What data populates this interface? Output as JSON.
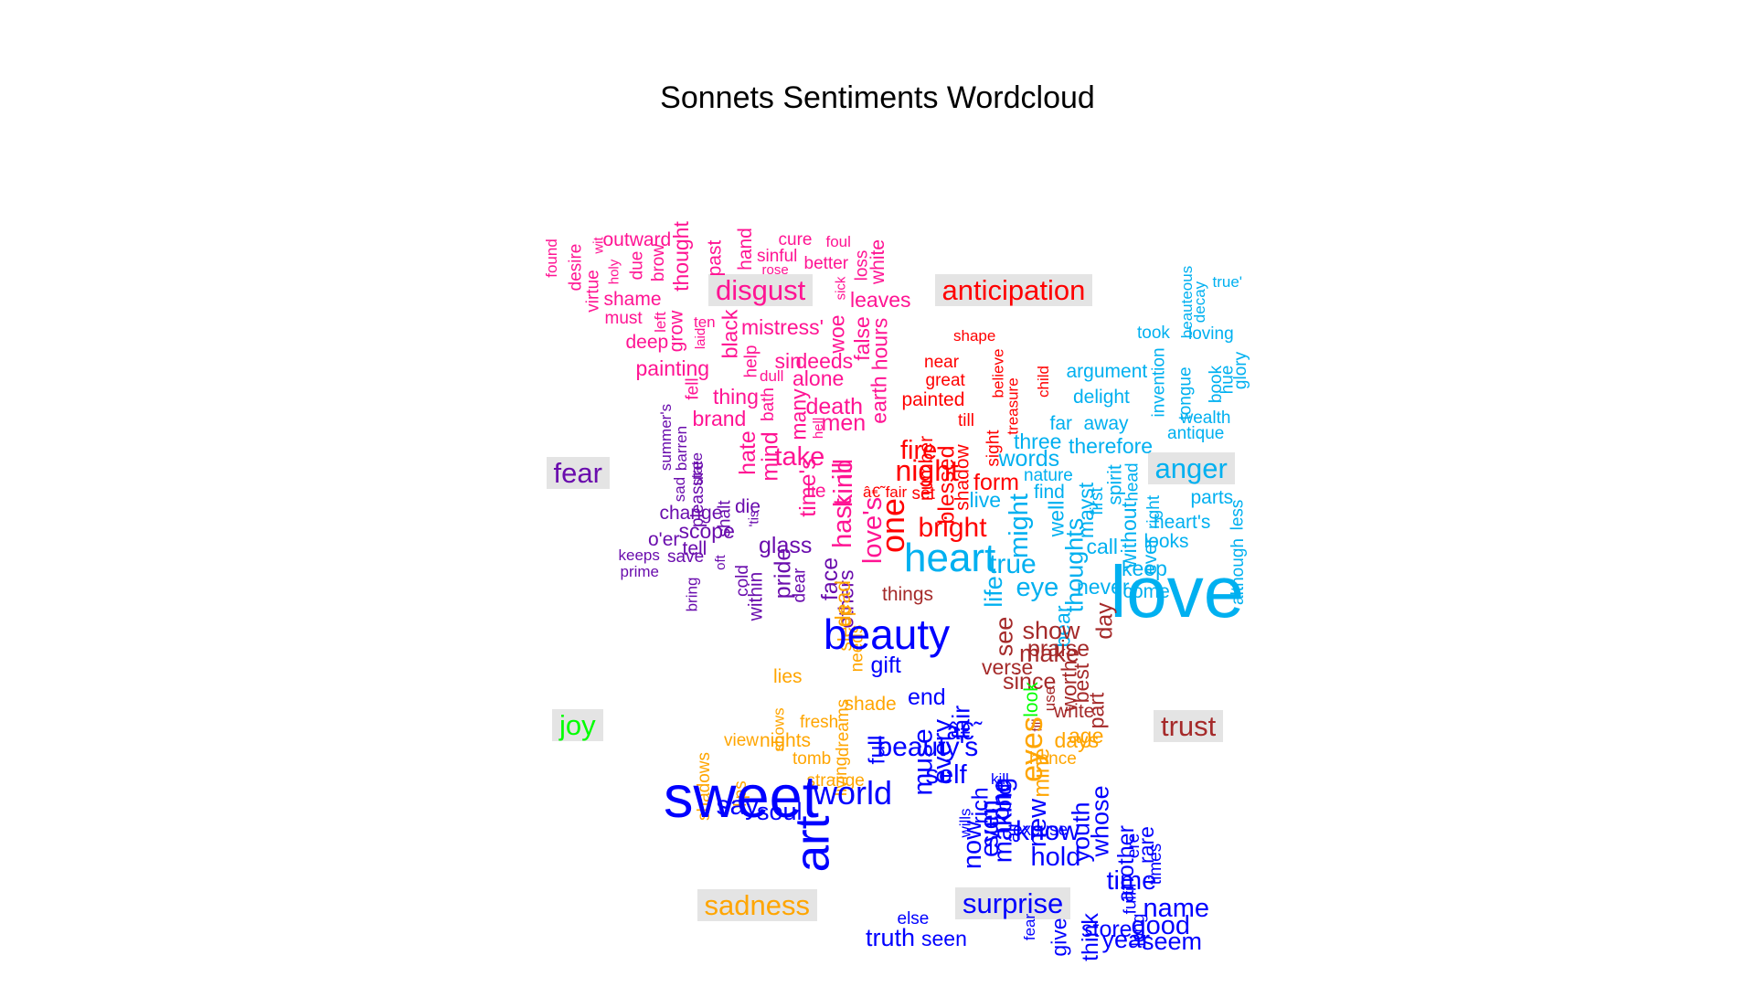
{
  "title": "Sonnets Sentiments Wordcloud",
  "colors": {
    "disgust": "#ff1493",
    "anticipation": "#ff0000",
    "fear": "#6a0dad",
    "anger": "#00b0f0",
    "joy": "#00ff00",
    "trust": "#a52a2a",
    "sadness": "#ffa500",
    "surprise": "#0000ff"
  },
  "labels": [
    "disgust",
    "anticipation",
    "fear",
    "anger",
    "joy",
    "trust",
    "sadness",
    "surprise"
  ],
  "words": [
    {
      "t": "found",
      "g": "disgust",
      "f": 0.9,
      "r": 1
    },
    {
      "t": "desire",
      "g": "disgust",
      "f": 1.0,
      "r": 1
    },
    {
      "t": "virtue",
      "g": "disgust",
      "f": 1.0,
      "r": 1
    },
    {
      "t": "wit",
      "g": "disgust",
      "f": 0.8,
      "r": 1
    },
    {
      "t": "holy",
      "g": "disgust",
      "f": 0.8,
      "r": 1
    },
    {
      "t": "outward",
      "g": "disgust",
      "f": 1.1,
      "r": 0
    },
    {
      "t": "due",
      "g": "disgust",
      "f": 1.0,
      "r": 1
    },
    {
      "t": "brow",
      "g": "disgust",
      "f": 1.0,
      "r": 1
    },
    {
      "t": "thought",
      "g": "disgust",
      "f": 1.2,
      "r": 1
    },
    {
      "t": "past",
      "g": "disgust",
      "f": 1.1,
      "r": 1
    },
    {
      "t": "hand",
      "g": "disgust",
      "f": 1.1,
      "r": 1
    },
    {
      "t": "cure",
      "g": "disgust",
      "f": 1.0,
      "r": 0
    },
    {
      "t": "foul",
      "g": "disgust",
      "f": 0.9,
      "r": 0
    },
    {
      "t": "sinful",
      "g": "disgust",
      "f": 1.0,
      "r": 0
    },
    {
      "t": "rose",
      "g": "disgust",
      "f": 0.8,
      "r": 0
    },
    {
      "t": "better",
      "g": "disgust",
      "f": 1.0,
      "r": 0
    },
    {
      "t": "sick",
      "g": "disgust",
      "f": 0.8,
      "r": 1
    },
    {
      "t": "loss",
      "g": "disgust",
      "f": 1.0,
      "r": 1
    },
    {
      "t": "white",
      "g": "disgust",
      "f": 1.1,
      "r": 1
    },
    {
      "t": "shame",
      "g": "disgust",
      "f": 1.1,
      "r": 0
    },
    {
      "t": "must",
      "g": "disgust",
      "f": 1.0,
      "r": 0
    },
    {
      "t": "left",
      "g": "disgust",
      "f": 0.9,
      "r": 1
    },
    {
      "t": "ten",
      "g": "disgust",
      "f": 0.9,
      "r": 0
    },
    {
      "t": "grow",
      "g": "disgust",
      "f": 1.1,
      "r": 1
    },
    {
      "t": "leaves",
      "g": "disgust",
      "f": 1.2,
      "r": 0
    },
    {
      "t": "deep",
      "g": "disgust",
      "f": 1.1,
      "r": 0
    },
    {
      "t": "laid",
      "g": "disgust",
      "f": 0.8,
      "r": 1
    },
    {
      "t": "black",
      "g": "disgust",
      "f": 1.2,
      "r": 1
    },
    {
      "t": "mistress'",
      "g": "disgust",
      "f": 1.2,
      "r": 0
    },
    {
      "t": "woe",
      "g": "disgust",
      "f": 1.2,
      "r": 1
    },
    {
      "t": "false",
      "g": "disgust",
      "f": 1.2,
      "r": 1
    },
    {
      "t": "painting",
      "g": "disgust",
      "f": 1.2,
      "r": 0
    },
    {
      "t": "help",
      "g": "disgust",
      "f": 1.0,
      "r": 1
    },
    {
      "t": "sin",
      "g": "disgust",
      "f": 1.2,
      "r": 0
    },
    {
      "t": "deeds",
      "g": "disgust",
      "f": 1.2,
      "r": 0
    },
    {
      "t": "fell",
      "g": "disgust",
      "f": 1.0,
      "r": 1
    },
    {
      "t": "dull",
      "g": "disgust",
      "f": 0.9,
      "r": 0
    },
    {
      "t": "alone",
      "g": "disgust",
      "f": 1.2,
      "r": 0
    },
    {
      "t": "thing",
      "g": "disgust",
      "f": 1.2,
      "r": 0
    },
    {
      "t": "bath",
      "g": "disgust",
      "f": 1.0,
      "r": 1
    },
    {
      "t": "death",
      "g": "disgust",
      "f": 1.3,
      "r": 0
    },
    {
      "t": "brand",
      "g": "disgust",
      "f": 1.2,
      "r": 0
    },
    {
      "t": "many",
      "g": "disgust",
      "f": 1.2,
      "r": 1
    },
    {
      "t": "men",
      "g": "disgust",
      "f": 1.3,
      "r": 0
    },
    {
      "t": "hell",
      "g": "disgust",
      "f": 0.8,
      "r": 1
    },
    {
      "t": "earth",
      "g": "disgust",
      "f": 1.2,
      "r": 1
    },
    {
      "t": "hours",
      "g": "disgust",
      "f": 1.2,
      "r": 1
    },
    {
      "t": "hate",
      "g": "disgust",
      "f": 1.3,
      "r": 1
    },
    {
      "t": "mind",
      "g": "disgust",
      "f": 1.3,
      "r": 1
    },
    {
      "t": "take",
      "g": "disgust",
      "f": 1.5,
      "r": 0
    },
    {
      "t": "time's",
      "g": "disgust",
      "f": 1.3,
      "r": 1
    },
    {
      "t": "lie",
      "g": "disgust",
      "f": 1.1,
      "r": 0
    },
    {
      "t": "ill",
      "g": "disgust",
      "f": 1.5,
      "r": 1
    },
    {
      "t": "kind",
      "g": "disgust",
      "f": 1.5,
      "r": 1
    },
    {
      "t": "hast",
      "g": "disgust",
      "f": 1.5,
      "r": 1
    },
    {
      "t": "love's",
      "g": "disgust",
      "f": 1.5,
      "r": 1
    },
    {
      "t": "shape",
      "g": "anticipation",
      "f": 0.9,
      "r": 0
    },
    {
      "t": "near",
      "g": "anticipation",
      "f": 1.0,
      "r": 0
    },
    {
      "t": "great",
      "g": "anticipation",
      "f": 1.0,
      "r": 0
    },
    {
      "t": "believe",
      "g": "anticipation",
      "f": 0.9,
      "r": 1
    },
    {
      "t": "child",
      "g": "anticipation",
      "f": 0.9,
      "r": 1
    },
    {
      "t": "painted",
      "g": "anticipation",
      "f": 1.1,
      "r": 0
    },
    {
      "t": "treasure",
      "g": "anticipation",
      "f": 0.9,
      "r": 1
    },
    {
      "t": "till",
      "g": "anticipation",
      "f": 1.0,
      "r": 0
    },
    {
      "t": "sight",
      "g": "anticipation",
      "f": 1.0,
      "r": 1
    },
    {
      "t": "number",
      "g": "anticipation",
      "f": 1.1,
      "r": 1
    },
    {
      "t": "shadow",
      "g": "anticipation",
      "f": 1.1,
      "r": 1
    },
    {
      "t": "fire",
      "g": "anticipation",
      "f": 1.5,
      "r": 0
    },
    {
      "t": "night",
      "g": "anticipation",
      "f": 1.7,
      "r": 0
    },
    {
      "t": "blessed",
      "g": "anticipation",
      "f": 1.3,
      "r": 1
    },
    {
      "t": "form",
      "g": "anticipation",
      "f": 1.3,
      "r": 0
    },
    {
      "t": "â€˜fair",
      "g": "anticipation",
      "f": 0.9,
      "r": 0
    },
    {
      "t": "set",
      "g": "anticipation",
      "f": 1.0,
      "r": 0
    },
    {
      "t": "one",
      "g": "anticipation",
      "f": 1.9,
      "r": 1
    },
    {
      "t": "bright",
      "g": "anticipation",
      "f": 1.6,
      "r": 0
    },
    {
      "t": "summer's",
      "g": "fear",
      "f": 0.9,
      "r": 1
    },
    {
      "t": "barren",
      "g": "fear",
      "f": 0.9,
      "r": 1
    },
    {
      "t": "sad",
      "g": "fear",
      "f": 0.9,
      "r": 1
    },
    {
      "t": "state",
      "g": "fear",
      "f": 0.9,
      "r": 1
    },
    {
      "t": "pleasure",
      "g": "fear",
      "f": 1.0,
      "r": 1
    },
    {
      "t": "change",
      "g": "fear",
      "f": 1.1,
      "r": 0
    },
    {
      "t": "shalt",
      "g": "fear",
      "f": 1.0,
      "r": 1
    },
    {
      "t": "die",
      "g": "fear",
      "f": 1.1,
      "r": 0
    },
    {
      "t": "scope",
      "g": "fear",
      "f": 1.2,
      "r": 0
    },
    {
      "t": "'tis",
      "g": "fear",
      "f": 0.8,
      "r": 1
    },
    {
      "t": "o'er",
      "g": "fear",
      "f": 1.1,
      "r": 0
    },
    {
      "t": "tell",
      "g": "fear",
      "f": 1.1,
      "r": 0
    },
    {
      "t": "glass",
      "g": "fear",
      "f": 1.3,
      "r": 0
    },
    {
      "t": "keeps",
      "g": "fear",
      "f": 0.9,
      "r": 0
    },
    {
      "t": "save",
      "g": "fear",
      "f": 1.0,
      "r": 0
    },
    {
      "t": "oft",
      "g": "fear",
      "f": 0.8,
      "r": 1
    },
    {
      "t": "cold",
      "g": "fear",
      "f": 1.0,
      "r": 1
    },
    {
      "t": "within",
      "g": "fear",
      "f": 1.1,
      "r": 1
    },
    {
      "t": "pride",
      "g": "fear",
      "f": 1.3,
      "r": 1
    },
    {
      "t": "dear",
      "g": "fear",
      "f": 1.0,
      "r": 1
    },
    {
      "t": "prime",
      "g": "fear",
      "f": 0.9,
      "r": 0
    },
    {
      "t": "bring",
      "g": "fear",
      "f": 0.9,
      "r": 1
    },
    {
      "t": "face",
      "g": "fear",
      "f": 1.3,
      "r": 1
    },
    {
      "t": "others",
      "g": "fear",
      "f": 1.2,
      "r": 1
    },
    {
      "t": "true'",
      "g": "anger",
      "f": 0.9,
      "r": 0
    },
    {
      "t": "beauteous",
      "g": "anger",
      "f": 0.9,
      "r": 1
    },
    {
      "t": "decay",
      "g": "anger",
      "f": 0.9,
      "r": 1
    },
    {
      "t": "took",
      "g": "anger",
      "f": 1.0,
      "r": 0
    },
    {
      "t": "loving",
      "g": "anger",
      "f": 1.0,
      "r": 0
    },
    {
      "t": "argument",
      "g": "anger",
      "f": 1.1,
      "r": 0
    },
    {
      "t": "invention",
      "g": "anger",
      "f": 1.0,
      "r": 1
    },
    {
      "t": "tongue",
      "g": "anger",
      "f": 1.0,
      "r": 1
    },
    {
      "t": "book",
      "g": "anger",
      "f": 1.0,
      "r": 1
    },
    {
      "t": "hue",
      "g": "anger",
      "f": 1.0,
      "r": 1
    },
    {
      "t": "glory",
      "g": "anger",
      "f": 1.0,
      "r": 1
    },
    {
      "t": "delight",
      "g": "anger",
      "f": 1.1,
      "r": 0
    },
    {
      "t": "antique",
      "g": "anger",
      "f": 1.0,
      "r": 0
    },
    {
      "t": "wealth",
      "g": "anger",
      "f": 1.0,
      "r": 0
    },
    {
      "t": "far",
      "g": "anger",
      "f": 1.1,
      "r": 0
    },
    {
      "t": "away",
      "g": "anger",
      "f": 1.1,
      "r": 0
    },
    {
      "t": "three",
      "g": "anger",
      "f": 1.2,
      "r": 0
    },
    {
      "t": "therefore",
      "g": "anger",
      "f": 1.2,
      "r": 0
    },
    {
      "t": "words",
      "g": "anger",
      "f": 1.3,
      "r": 0
    },
    {
      "t": "nature",
      "g": "anger",
      "f": 1.0,
      "r": 0
    },
    {
      "t": "find",
      "g": "anger",
      "f": 1.1,
      "r": 0
    },
    {
      "t": "first",
      "g": "anger",
      "f": 1.0,
      "r": 1
    },
    {
      "t": "spirit",
      "g": "anger",
      "f": 1.1,
      "r": 1
    },
    {
      "t": "head",
      "g": "anger",
      "f": 1.0,
      "r": 1
    },
    {
      "t": "parts",
      "g": "anger",
      "f": 1.1,
      "r": 0
    },
    {
      "t": "live",
      "g": "anger",
      "f": 1.2,
      "r": 0
    },
    {
      "t": "might",
      "g": "anger",
      "f": 1.5,
      "r": 1
    },
    {
      "t": "well",
      "g": "anger",
      "f": 1.2,
      "r": 1
    },
    {
      "t": "mayst",
      "g": "anger",
      "f": 1.2,
      "r": 1
    },
    {
      "t": "right",
      "g": "anger",
      "f": 1.0,
      "r": 1
    },
    {
      "t": "heart's",
      "g": "anger",
      "f": 1.1,
      "r": 0
    },
    {
      "t": "less",
      "g": "anger",
      "f": 1.0,
      "r": 1
    },
    {
      "t": "call",
      "g": "anger",
      "f": 1.2,
      "r": 0
    },
    {
      "t": "without",
      "g": "anger",
      "f": 1.2,
      "r": 1
    },
    {
      "t": "looks",
      "g": "anger",
      "f": 1.1,
      "r": 0
    },
    {
      "t": "ever",
      "g": "anger",
      "f": 1.1,
      "r": 1
    },
    {
      "t": "keep",
      "g": "anger",
      "f": 1.2,
      "r": 0
    },
    {
      "t": "although",
      "g": "anger",
      "f": 1.0,
      "r": 1
    },
    {
      "t": "heart",
      "g": "anger",
      "f": 2.3,
      "r": 0
    },
    {
      "t": "true",
      "g": "anger",
      "f": 1.6,
      "r": 0
    },
    {
      "t": "eye",
      "g": "anger",
      "f": 1.5,
      "r": 0
    },
    {
      "t": "life",
      "g": "anger",
      "f": 1.4,
      "r": 1
    },
    {
      "t": "thoughts",
      "g": "anger",
      "f": 1.4,
      "r": 1
    },
    {
      "t": "bear",
      "g": "anger",
      "f": 1.2,
      "r": 1
    },
    {
      "t": "never",
      "g": "anger",
      "f": 1.2,
      "r": 0
    },
    {
      "t": "come",
      "g": "anger",
      "f": 1.1,
      "r": 0
    },
    {
      "t": "love",
      "g": "anger",
      "f": 4.2,
      "r": 0
    },
    {
      "t": "things",
      "g": "trust",
      "f": 1.1,
      "r": 0
    },
    {
      "t": "day",
      "g": "trust",
      "f": 1.3,
      "r": 1
    },
    {
      "t": "show",
      "g": "trust",
      "f": 1.4,
      "r": 0
    },
    {
      "t": "see",
      "g": "trust",
      "f": 1.4,
      "r": 1
    },
    {
      "t": "make",
      "g": "trust",
      "f": 1.4,
      "r": 0
    },
    {
      "t": "praise",
      "g": "trust",
      "f": 1.3,
      "r": 0
    },
    {
      "t": "since",
      "g": "trust",
      "f": 1.3,
      "r": 0
    },
    {
      "t": "best",
      "g": "trust",
      "f": 1.2,
      "r": 1
    },
    {
      "t": "verse",
      "g": "trust",
      "f": 1.2,
      "r": 0
    },
    {
      "t": "write",
      "g": "trust",
      "f": 1.1,
      "r": 0
    },
    {
      "t": "worth",
      "g": "trust",
      "f": 1.2,
      "r": 1
    },
    {
      "t": "part",
      "g": "trust",
      "f": 1.2,
      "r": 1
    },
    {
      "t": "use",
      "g": "trust",
      "f": 0.9,
      "r": 1
    },
    {
      "t": "fill",
      "g": "trust",
      "f": 0.8,
      "r": 1
    },
    {
      "t": "look",
      "g": "joy",
      "f": 1.1,
      "r": 1
    },
    {
      "t": "age",
      "g": "sadness",
      "f": 1.2,
      "r": 0
    },
    {
      "t": "hence",
      "g": "sadness",
      "f": 1.0,
      "r": 0
    },
    {
      "t": "eyes",
      "g": "sadness",
      "f": 1.8,
      "r": 1
    },
    {
      "t": "days",
      "g": "sadness",
      "f": 1.2,
      "r": 0
    },
    {
      "t": "mine",
      "g": "sadness",
      "f": 1.3,
      "r": 1
    },
    {
      "t": "dead",
      "g": "sadness",
      "f": 1.2,
      "r": 1
    },
    {
      "t": "sleep",
      "g": "sadness",
      "f": 1.1,
      "r": 1
    },
    {
      "t": "needs",
      "g": "sadness",
      "f": 1.0,
      "r": 1
    },
    {
      "t": "lies",
      "g": "sadness",
      "f": 1.1,
      "r": 0
    },
    {
      "t": "shade",
      "g": "sadness",
      "f": 1.1,
      "r": 0
    },
    {
      "t": "fresh",
      "g": "sadness",
      "f": 1.0,
      "r": 0
    },
    {
      "t": "dreams",
      "g": "sadness",
      "f": 1.0,
      "r": 1
    },
    {
      "t": "shows",
      "g": "sadness",
      "f": 0.9,
      "r": 1
    },
    {
      "t": "view",
      "g": "sadness",
      "f": 1.0,
      "r": 0
    },
    {
      "t": "nights",
      "g": "sadness",
      "f": 1.1,
      "r": 0
    },
    {
      "t": "tomb",
      "g": "sadness",
      "f": 1.0,
      "r": 0
    },
    {
      "t": "living",
      "g": "sadness",
      "f": 1.0,
      "r": 1
    },
    {
      "t": "shadows",
      "g": "sadness",
      "f": 1.0,
      "r": 1
    },
    {
      "t": "lips",
      "g": "sadness",
      "f": 1.0,
      "r": 1
    },
    {
      "t": "strange",
      "g": "sadness",
      "f": 1.0,
      "r": 0
    },
    {
      "t": "world",
      "g": "surprise",
      "f": 1.9,
      "r": 0
    },
    {
      "t": "sweet",
      "g": "surprise",
      "f": 3.4,
      "r": 0
    },
    {
      "t": "say",
      "g": "surprise",
      "f": 1.6,
      "r": 0
    },
    {
      "t": "soul",
      "g": "surprise",
      "f": 1.4,
      "r": 0
    },
    {
      "t": "art",
      "g": "surprise",
      "f": 2.8,
      "r": 1
    },
    {
      "t": "beauty",
      "g": "surprise",
      "f": 2.4,
      "r": 0
    },
    {
      "t": "gift",
      "g": "surprise",
      "f": 1.3,
      "r": 0
    },
    {
      "t": "end",
      "g": "surprise",
      "f": 1.3,
      "r": 0
    },
    {
      "t": "fair",
      "g": "surprise",
      "f": 1.4,
      "r": 1
    },
    {
      "t": "full",
      "g": "surprise",
      "f": 1.3,
      "r": 1
    },
    {
      "t": "â€˜",
      "g": "surprise",
      "f": 1.4,
      "r": 0
    },
    {
      "t": "beauty's",
      "g": "surprise",
      "f": 1.6,
      "r": 0
    },
    {
      "t": "muse",
      "g": "surprise",
      "f": 1.6,
      "r": 1
    },
    {
      "t": "every",
      "g": "surprise",
      "f": 1.5,
      "r": 1
    },
    {
      "t": "self",
      "g": "surprise",
      "f": 1.5,
      "r": 0
    },
    {
      "t": "kill",
      "g": "surprise",
      "f": 0.9,
      "r": 0
    },
    {
      "t": "none",
      "g": "surprise",
      "f": 1.4,
      "r": 1
    },
    {
      "t": "old",
      "g": "surprise",
      "f": 1.2,
      "r": 1
    },
    {
      "t": "rich",
      "g": "surprise",
      "f": 1.3,
      "r": 1
    },
    {
      "t": "making",
      "g": "surprise",
      "f": 1.5,
      "r": 1
    },
    {
      "t": "even",
      "g": "surprise",
      "f": 1.5,
      "r": 1
    },
    {
      "t": "wills",
      "g": "surprise",
      "f": 0.9,
      "r": 1
    },
    {
      "t": "now",
      "g": "surprise",
      "f": 1.5,
      "r": 1
    },
    {
      "t": "new",
      "g": "surprise",
      "f": 1.5,
      "r": 1
    },
    {
      "t": "sun",
      "g": "surprise",
      "f": 1.4,
      "r": 1
    },
    {
      "t": "air",
      "g": "surprise",
      "f": 1.1,
      "r": 1
    },
    {
      "t": "know",
      "g": "surprise",
      "f": 1.6,
      "r": 0
    },
    {
      "t": "excuse",
      "g": "surprise",
      "f": 1.0,
      "r": 0
    },
    {
      "t": "hold",
      "g": "surprise",
      "f": 1.5,
      "r": 0
    },
    {
      "t": "youth",
      "g": "surprise",
      "f": 1.4,
      "r": 1
    },
    {
      "t": "whose",
      "g": "surprise",
      "f": 1.4,
      "r": 1
    },
    {
      "t": "ere",
      "g": "surprise",
      "f": 1.0,
      "r": 1
    },
    {
      "t": "another",
      "g": "surprise",
      "f": 1.3,
      "r": 1
    },
    {
      "t": "times",
      "g": "surprise",
      "f": 1.0,
      "r": 1
    },
    {
      "t": "rare",
      "g": "surprise",
      "f": 1.2,
      "r": 1
    },
    {
      "t": "fulfil",
      "g": "surprise",
      "f": 1.0,
      "r": 1
    },
    {
      "t": "time",
      "g": "surprise",
      "f": 1.5,
      "r": 0
    },
    {
      "t": "else",
      "g": "surprise",
      "f": 1.0,
      "r": 0
    },
    {
      "t": "truth",
      "g": "surprise",
      "f": 1.4,
      "r": 0
    },
    {
      "t": "seen",
      "g": "surprise",
      "f": 1.2,
      "r": 0
    },
    {
      "t": "fear",
      "g": "surprise",
      "f": 0.9,
      "r": 1
    },
    {
      "t": "give",
      "g": "surprise",
      "f": 1.2,
      "r": 1
    },
    {
      "t": "think",
      "g": "surprise",
      "f": 1.3,
      "r": 1
    },
    {
      "t": "store",
      "g": "surprise",
      "f": 1.3,
      "r": 0
    },
    {
      "t": "year",
      "g": "surprise",
      "f": 1.4,
      "r": 0
    },
    {
      "t": "long",
      "g": "surprise",
      "f": 1.0,
      "r": 1
    },
    {
      "t": "good",
      "g": "surprise",
      "f": 1.5,
      "r": 0
    },
    {
      "t": "name",
      "g": "surprise",
      "f": 1.5,
      "r": 0
    },
    {
      "t": "seem",
      "g": "surprise",
      "f": 1.4,
      "r": 0
    }
  ]
}
